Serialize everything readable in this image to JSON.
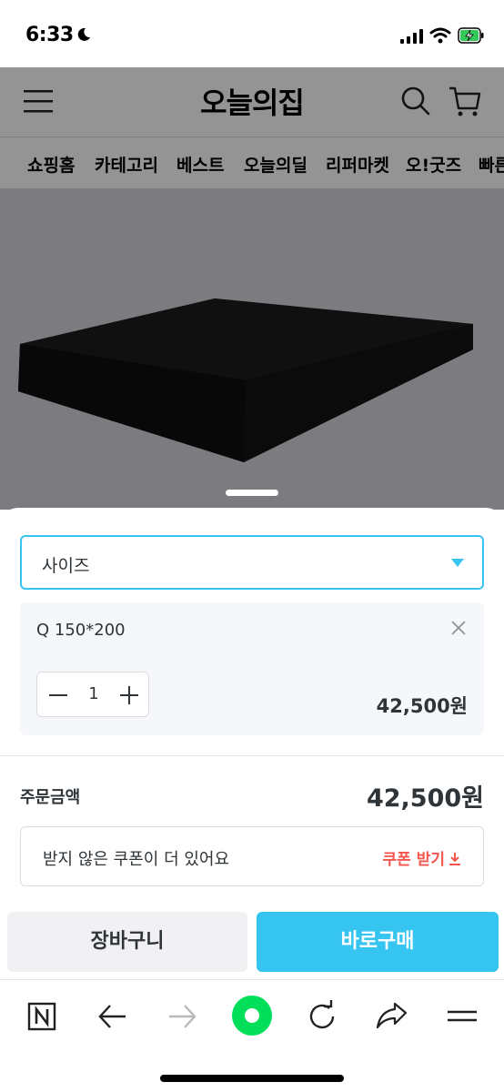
{
  "status_bar": {
    "time": "6:33"
  },
  "header": {
    "logo": "오늘의집",
    "nav": [
      "쇼핑홈",
      "카테고리",
      "베스트",
      "오늘의딜",
      "리퍼마켓",
      "오!굿즈",
      "빠른"
    ]
  },
  "sheet": {
    "select": {
      "label": "사이즈"
    },
    "option": {
      "name": "Q 150*200",
      "quantity": "1",
      "price": "42,500원"
    },
    "total": {
      "label": "주문금액",
      "price": "42,500원"
    },
    "coupon": {
      "text": "받지 않은 쿠폰이 더 있어요",
      "button": "쿠폰 받기"
    },
    "buttons": {
      "cart": "장바구니",
      "buy": "바로구매"
    }
  },
  "colors": {
    "accent": "#35c5f0",
    "coupon": "#f4564e",
    "browser_green": "#00de5a"
  }
}
